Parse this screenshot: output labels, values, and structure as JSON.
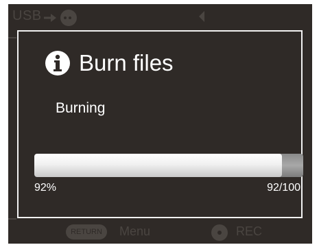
{
  "topbar": {
    "usb_label": "USB"
  },
  "bottombar": {
    "return_label": "RETURN",
    "menu_label": "Menu",
    "rec_label": "REC"
  },
  "dialog": {
    "title": "Burn files",
    "status": "Burning",
    "progress": {
      "fraction": 0.92,
      "percent_label": "92%",
      "count_label": "92/100"
    }
  },
  "colors": {
    "screen_background": "#2f2a27",
    "dim_text": "#4a4541",
    "dialog_border": "#f2f2f2",
    "text": "#ffffff"
  },
  "icons": {
    "info": "info-icon",
    "usb_plug": "usb-plug-icon",
    "left_arrow": "left-arrow-icon",
    "rec": "rec-icon"
  }
}
